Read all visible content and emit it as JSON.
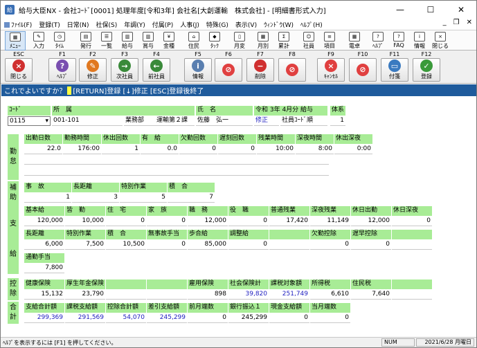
{
  "window": {
    "title": "給与大臣NX - 会社ｺｰﾄﾞ[0001] 処理年度[令和3年] 会社名[大創運輸　株式会社] - [明細書形式入力]",
    "minimize": "—",
    "maximize": "☐",
    "close": "✕"
  },
  "menu": {
    "items": [
      "ﾌｧｲﾙ(F)",
      "登録(T)",
      "日常(N)",
      "社保(S)",
      "年調(Y)",
      "付属(P)",
      "人事(J)",
      "特殊(G)",
      "表示(V)",
      "ｳｨﾝﾄﾞｳ(W)",
      "ﾍﾙﾌﾟ(H)"
    ],
    "min": "_",
    "restore": "❐",
    "close": "✕"
  },
  "toolbar": {
    "items": [
      "ﾒﾆｭｰ",
      "入力",
      "ﾀｲﾑ",
      "発行",
      "一覧",
      "給与",
      "賞与",
      "金種",
      "住民",
      "ﾀｯｸ",
      "月変",
      "月別",
      "累計",
      "社員",
      "項目",
      "電卓",
      "ﾍﾙﾌﾟ",
      "FAQ",
      "情報",
      "閉じる"
    ]
  },
  "fkeys": [
    {
      "key": "ESC",
      "label": "閉じる",
      "color": "#d03030",
      "glyph": "×"
    },
    {
      "key": "F1",
      "label": "ﾍﾙﾌﾟ",
      "color": "#7a4fb0",
      "glyph": "?"
    },
    {
      "key": "F2",
      "label": "修正",
      "color": "#e07820",
      "glyph": "✎"
    },
    {
      "key": "F3",
      "label": "次社員",
      "color": "#3a8a3a",
      "glyph": "→"
    },
    {
      "key": "F4",
      "label": "前社員",
      "color": "#3a8a3a",
      "glyph": "←"
    },
    {
      "key": "F5",
      "label": "情報",
      "color": "#5a7fb0",
      "glyph": "i"
    },
    {
      "key": "F6",
      "label": "",
      "color": "#e04040",
      "glyph": "⊘"
    },
    {
      "key": "F7",
      "label": "削除",
      "color": "#d03030",
      "glyph": "−"
    },
    {
      "key": "F8",
      "label": "",
      "color": "#e04040",
      "glyph": "⊘"
    },
    {
      "key": "F9",
      "label": "ｷｬﾝｾﾙ",
      "color": "#e04040",
      "glyph": "×"
    },
    {
      "key": "F10",
      "label": "",
      "color": "#e04040",
      "glyph": "⊘"
    },
    {
      "key": "F11",
      "label": "付箋",
      "color": "#3a7ac0",
      "glyph": "▭"
    },
    {
      "key": "F12",
      "label": "登録",
      "color": "#3a9a3a",
      "glyph": "✓"
    }
  ],
  "prompt": {
    "pre": "これでよいですか？",
    "post": "[RETURN]登録 [↓]修正 [ESC]登録後終了"
  },
  "header": {
    "code_label": "ｺｰﾄﾞ",
    "code_value": "0115",
    "dept_label": "所　属",
    "dept_code": "001-101",
    "dept_name": "業務部　　運輸第２課",
    "name_label": "氏　名",
    "name_value": "佐藤　弘一",
    "period_label": "令和 3年 4月分 給与",
    "fix_label": "修正",
    "order_label": "社員ｺｰﾄﾞ順",
    "system_label": "体系",
    "system_value": "1"
  },
  "attendance": {
    "side": [
      "勤",
      "怠"
    ],
    "labels": [
      "出勤日数",
      "勤務時間",
      "休出回数",
      "有　給",
      "欠勤回数",
      "遅刻回数",
      "残業時間",
      "深夜時間",
      "休出深夜"
    ],
    "values": [
      "22.0",
      "176:00",
      "1",
      "0.0",
      "0",
      "0",
      "10:00",
      "8:00",
      "0:00"
    ]
  },
  "aux": {
    "side": [
      "補",
      "助"
    ],
    "labels": [
      "事　故",
      "長距離",
      "特別作業",
      "積　合"
    ],
    "values": [
      "1",
      "3",
      "5",
      "7"
    ]
  },
  "pay": {
    "side": [
      "支",
      "給"
    ],
    "row1_labels": [
      "基本給",
      "皆　勤",
      "住　宅",
      "家　族",
      "職　務",
      "役　職",
      "普通残業",
      "深夜残業",
      "休日出勤",
      "休日深夜"
    ],
    "row1_values": [
      "120,000",
      "10,000",
      "0",
      "0",
      "12,000",
      "0",
      "17,420",
      "11,149",
      "12,000",
      "0"
    ],
    "row2_labels": [
      "長距離",
      "特別作業",
      "積　合",
      "無事故手当",
      "歩合給",
      "調整給",
      "",
      "欠勤控除",
      "遅早控除",
      ""
    ],
    "row2_values": [
      "6,000",
      "7,500",
      "10,500",
      "0",
      "85,000",
      "0",
      "",
      "0",
      "0",
      ""
    ],
    "row3_labels": [
      "通勤手当"
    ],
    "row3_values": [
      "7,800"
    ]
  },
  "deduction": {
    "side": [
      "控",
      "除"
    ],
    "labels": [
      "健康保険",
      "厚生年金保険",
      "",
      "",
      "雇用保険",
      "社会保険計",
      "課税対象額",
      "所得税",
      "住民税",
      ""
    ],
    "values": [
      "15,132",
      "23,790",
      "",
      "",
      "898",
      "39,820",
      "251,749",
      "6,610",
      "7,640",
      ""
    ]
  },
  "total": {
    "side": [
      "合",
      "計"
    ],
    "labels": [
      "支給合計額",
      "課税支給額",
      "控除合計額",
      "差引支給額",
      "前月端数",
      "銀行振込１",
      "現金支給額",
      "当月端数"
    ],
    "values": [
      "299,369",
      "291,569",
      "54,070",
      "245,299",
      "0",
      "245,299",
      "0",
      "0"
    ]
  },
  "status": {
    "help": "ﾍﾙﾌﾟを表示するには [F1] を押してください。",
    "num": "NUM",
    "date": "2021/6/28 月曜日"
  }
}
